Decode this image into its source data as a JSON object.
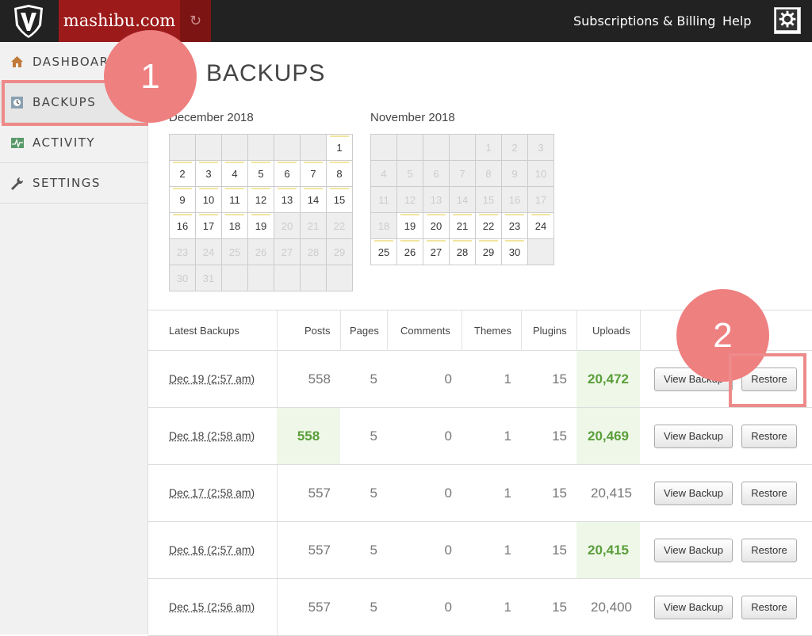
{
  "topbar": {
    "site_name": "mashibu.com",
    "nav": [
      "Subscriptions & Billing",
      "Help"
    ],
    "icons": {
      "logo": "vaultpress-v-logo",
      "sync": "sync-icon",
      "settings": "gear-icon"
    }
  },
  "sidebar": {
    "items": [
      {
        "label": "DASHBOARD",
        "icon": "home-icon"
      },
      {
        "label": "BACKUPS",
        "icon": "backup-icon"
      },
      {
        "label": "ACTIVITY",
        "icon": "activity-icon"
      },
      {
        "label": "SETTINGS",
        "icon": "wrench-icon"
      }
    ],
    "active": "BACKUPS"
  },
  "annotations": {
    "step1": "1",
    "step2": "2",
    "color": "#ef8080"
  },
  "main": {
    "title": "BACKUPS"
  },
  "calendars": [
    {
      "title": "December 2018",
      "cells": [
        {
          "t": "e"
        },
        {
          "t": "e"
        },
        {
          "t": "e"
        },
        {
          "t": "e"
        },
        {
          "t": "e"
        },
        {
          "t": "e"
        },
        {
          "d": "1",
          "t": "b"
        },
        {
          "d": "2",
          "t": "b"
        },
        {
          "d": "3",
          "t": "b"
        },
        {
          "d": "4",
          "t": "b"
        },
        {
          "d": "5",
          "t": "b"
        },
        {
          "d": "6",
          "t": "b"
        },
        {
          "d": "7",
          "t": "b"
        },
        {
          "d": "8",
          "t": "b"
        },
        {
          "d": "9",
          "t": "b"
        },
        {
          "d": "10",
          "t": "b"
        },
        {
          "d": "11",
          "t": "b"
        },
        {
          "d": "12",
          "t": "b"
        },
        {
          "d": "13",
          "t": "b"
        },
        {
          "d": "14",
          "t": "b"
        },
        {
          "d": "15",
          "t": "b"
        },
        {
          "d": "16",
          "t": "b"
        },
        {
          "d": "17",
          "t": "b"
        },
        {
          "d": "18",
          "t": "b"
        },
        {
          "d": "19",
          "t": "b"
        },
        {
          "d": "20",
          "t": "d"
        },
        {
          "d": "21",
          "t": "d"
        },
        {
          "d": "22",
          "t": "d"
        },
        {
          "d": "23",
          "t": "d"
        },
        {
          "d": "24",
          "t": "d"
        },
        {
          "d": "25",
          "t": "d"
        },
        {
          "d": "26",
          "t": "d"
        },
        {
          "d": "27",
          "t": "d"
        },
        {
          "d": "28",
          "t": "d"
        },
        {
          "d": "29",
          "t": "d"
        },
        {
          "d": "30",
          "t": "d"
        },
        {
          "d": "31",
          "t": "d"
        },
        {
          "t": "e"
        },
        {
          "t": "e"
        },
        {
          "t": "e"
        },
        {
          "t": "e"
        },
        {
          "t": "e"
        }
      ]
    },
    {
      "title": "November 2018",
      "cells": [
        {
          "t": "e"
        },
        {
          "t": "e"
        },
        {
          "t": "e"
        },
        {
          "t": "e"
        },
        {
          "d": "1",
          "t": "d"
        },
        {
          "d": "2",
          "t": "d"
        },
        {
          "d": "3",
          "t": "d"
        },
        {
          "d": "4",
          "t": "d"
        },
        {
          "d": "5",
          "t": "d"
        },
        {
          "d": "6",
          "t": "d"
        },
        {
          "d": "7",
          "t": "d"
        },
        {
          "d": "8",
          "t": "d"
        },
        {
          "d": "9",
          "t": "d"
        },
        {
          "d": "10",
          "t": "d"
        },
        {
          "d": "11",
          "t": "d"
        },
        {
          "d": "12",
          "t": "d"
        },
        {
          "d": "13",
          "t": "d"
        },
        {
          "d": "14",
          "t": "d"
        },
        {
          "d": "15",
          "t": "d"
        },
        {
          "d": "16",
          "t": "d"
        },
        {
          "d": "17",
          "t": "d"
        },
        {
          "d": "18",
          "t": "d"
        },
        {
          "d": "19",
          "t": "b"
        },
        {
          "d": "20",
          "t": "b"
        },
        {
          "d": "21",
          "t": "b"
        },
        {
          "d": "22",
          "t": "b"
        },
        {
          "d": "23",
          "t": "b"
        },
        {
          "d": "24",
          "t": "b"
        },
        {
          "d": "25",
          "t": "b"
        },
        {
          "d": "26",
          "t": "b"
        },
        {
          "d": "27",
          "t": "b"
        },
        {
          "d": "28",
          "t": "b"
        },
        {
          "d": "29",
          "t": "b"
        },
        {
          "d": "30",
          "t": "b"
        },
        {
          "t": "e"
        }
      ]
    }
  ],
  "table": {
    "headers": [
      "Latest Backups",
      "Posts",
      "Pages",
      "Comments",
      "Themes",
      "Plugins",
      "Uploads"
    ],
    "rows": [
      {
        "date": "Dec 19 (2:57 am)",
        "posts": "558",
        "pages": "5",
        "comments": "0",
        "themes": "1",
        "plugins": "15",
        "uploads": "20,472",
        "hi_posts": false,
        "hi_uploads": true
      },
      {
        "date": "Dec 18 (2:58 am)",
        "posts": "558",
        "pages": "5",
        "comments": "0",
        "themes": "1",
        "plugins": "15",
        "uploads": "20,469",
        "hi_posts": true,
        "hi_uploads": true
      },
      {
        "date": "Dec 17 (2:58 am)",
        "posts": "557",
        "pages": "5",
        "comments": "0",
        "themes": "1",
        "plugins": "15",
        "uploads": "20,415",
        "hi_posts": false,
        "hi_uploads": false
      },
      {
        "date": "Dec 16 (2:57 am)",
        "posts": "557",
        "pages": "5",
        "comments": "0",
        "themes": "1",
        "plugins": "15",
        "uploads": "20,415",
        "hi_posts": false,
        "hi_uploads": true
      },
      {
        "date": "Dec 15 (2:56 am)",
        "posts": "557",
        "pages": "5",
        "comments": "0",
        "themes": "1",
        "plugins": "15",
        "uploads": "20,400",
        "hi_posts": false,
        "hi_uploads": false
      }
    ],
    "view_label": "View Backup",
    "restore_label": "Restore"
  }
}
